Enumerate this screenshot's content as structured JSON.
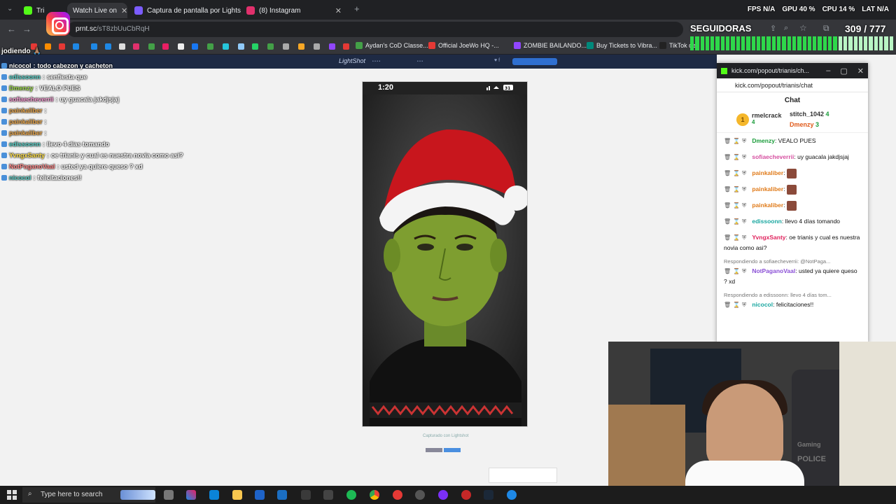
{
  "browser": {
    "tabs": [
      {
        "label": "Tri",
        "color": "#53fc18"
      },
      {
        "label": "Watch Live on",
        "color": "#53fc18"
      },
      {
        "label": "Captura de pantalla por Lightsh",
        "color": "#7b5cff"
      },
      {
        "label": "(8) Instagram",
        "color": "#e1306c"
      }
    ],
    "new_tab_label": "+",
    "url": {
      "host": "prnt.sc",
      "path": "/sT8zbUuCbRqH"
    },
    "bookmarks": [
      "Aydan's CoD Classe...",
      "Official JoeWo HQ -...",
      "ZOMBIE BAILANDO...",
      "Buy Tickets to Vibra...",
      "TikTok de"
    ]
  },
  "overlay": {
    "stats": [
      {
        "label": "FPS",
        "value": "N/A"
      },
      {
        "label": "GPU",
        "value": "40 %"
      },
      {
        "label": "CPU",
        "value": "14 %"
      },
      {
        "label": "LAT",
        "value": "N/A"
      }
    ],
    "followers_label": "SEGUIDORAS",
    "counter": "309 / 777",
    "streamer_name": "jodiendo 🙏🏽",
    "goal_progress": 0.4
  },
  "lightshot": {
    "logo": "LightShot",
    "phone_time": "1:20",
    "battery": "31",
    "caption": "Capturado con Lightshot"
  },
  "overlay_chat": [
    {
      "user": "nicocol",
      "text": "todo cabezon y cacheton",
      "color": "#ffffff"
    },
    {
      "user": "edissoonn",
      "text": "senfiesta que",
      "color": "#5ad1c8"
    },
    {
      "user": "Dmenzy",
      "text": "VEALO PUES",
      "color": "#9bd84a"
    },
    {
      "user": "sofiaecheverrii",
      "text": "uy guacala jakdjsjaj",
      "color": "#f59ad1"
    },
    {
      "user": "painkaliber",
      "text": "",
      "color": "#e8a54a"
    },
    {
      "user": "painkaliber",
      "text": "",
      "color": "#e8a54a"
    },
    {
      "user": "painkaliber",
      "text": "",
      "color": "#e8a54a"
    },
    {
      "user": "edissoonn",
      "text": "llevo 4 días tomando",
      "color": "#5ad1c8"
    },
    {
      "user": "YvngxSanty",
      "text": "oe trianis y cual es nuestra novia como asi?",
      "color": "#ffe04a"
    },
    {
      "user": "NotPaganoVaal",
      "text": "usted ya quiere queso ? xd",
      "color": "#f88"
    },
    {
      "user": "nicocol",
      "text": "felicitaciones!!",
      "color": "#5ad1c8"
    }
  ],
  "kick": {
    "window_title": "kick.com/popout/trianis/ch...",
    "url": "kick.com/popout/trianis/chat",
    "header": "Chat",
    "top_gifters": [
      {
        "rank": "1",
        "name": "rmelcrack",
        "count": "4"
      },
      {
        "name": "stitch_1042",
        "count": "4"
      },
      {
        "name": "Dmenzy",
        "count": "3"
      }
    ],
    "messages": [
      {
        "user": "Dmenzy",
        "text": "VEALO PUES",
        "color": "#1a9c3a",
        "reply": ""
      },
      {
        "user": "sofiaecheverrii",
        "text": "uy guacala jakdjsjaj",
        "color": "#d64fa0",
        "reply": ""
      },
      {
        "user": "painkaliber",
        "text": "",
        "color": "#e07b1a",
        "reply": "",
        "emote": true
      },
      {
        "user": "painkaliber",
        "text": "",
        "color": "#e07b1a",
        "reply": "",
        "emote": true
      },
      {
        "user": "painkaliber",
        "text": "",
        "color": "#e07b1a",
        "reply": "",
        "emote": true
      },
      {
        "user": "edissoonn",
        "text": "llevo 4 días tomando",
        "color": "#1aa7a0",
        "reply": ""
      },
      {
        "user": "YvngxSanty",
        "text": "oe trianis y cual es nuestra novia como asi?",
        "color": "#e0245e",
        "reply": ""
      },
      {
        "user": "NotPaganoVaal",
        "text": "usted ya quiere queso ? xd",
        "color": "#8a4fd6",
        "reply": "Respondiendo a sofiaecheverrii: @NotPaga..."
      },
      {
        "user": "nicocol",
        "text": "felicitaciones!!",
        "color": "#1aa7a0",
        "reply": "Respondiendo a edissoonn: llevo 4 días tom..."
      }
    ]
  },
  "cam": {
    "chair_text": "Gaming",
    "police_text": "POLICE"
  },
  "taskbar": {
    "search_placeholder": "Type here to search"
  }
}
